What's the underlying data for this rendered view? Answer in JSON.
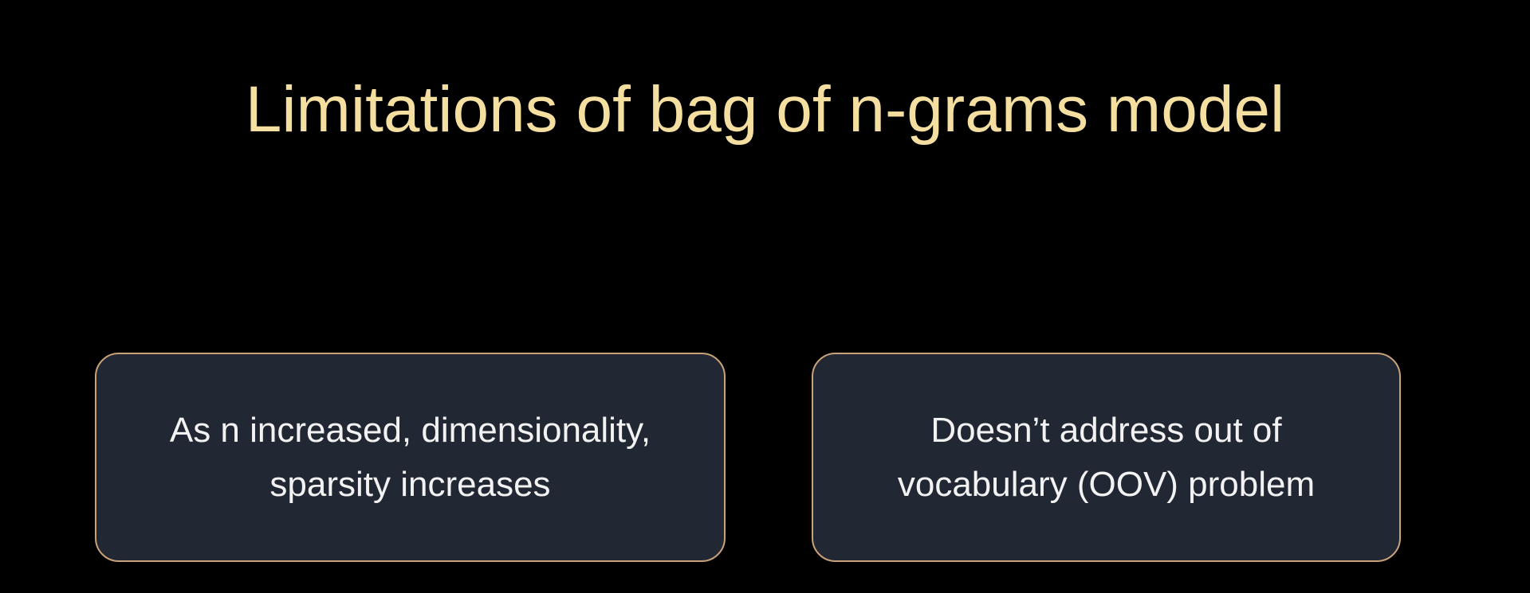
{
  "slide": {
    "title": "Limitations of bag of n-grams model",
    "cards": [
      {
        "lines": [
          "As n increased, dimensionality,",
          "sparsity increases"
        ]
      },
      {
        "lines": [
          "Doesn’t address out of",
          "vocabulary (OOV) problem"
        ]
      }
    ]
  },
  "colors": {
    "background": "#000000",
    "title": "#f4dfa0",
    "card_fill": "#212733",
    "card_border": "#c9a27a",
    "card_text": "#f2f2f2"
  }
}
